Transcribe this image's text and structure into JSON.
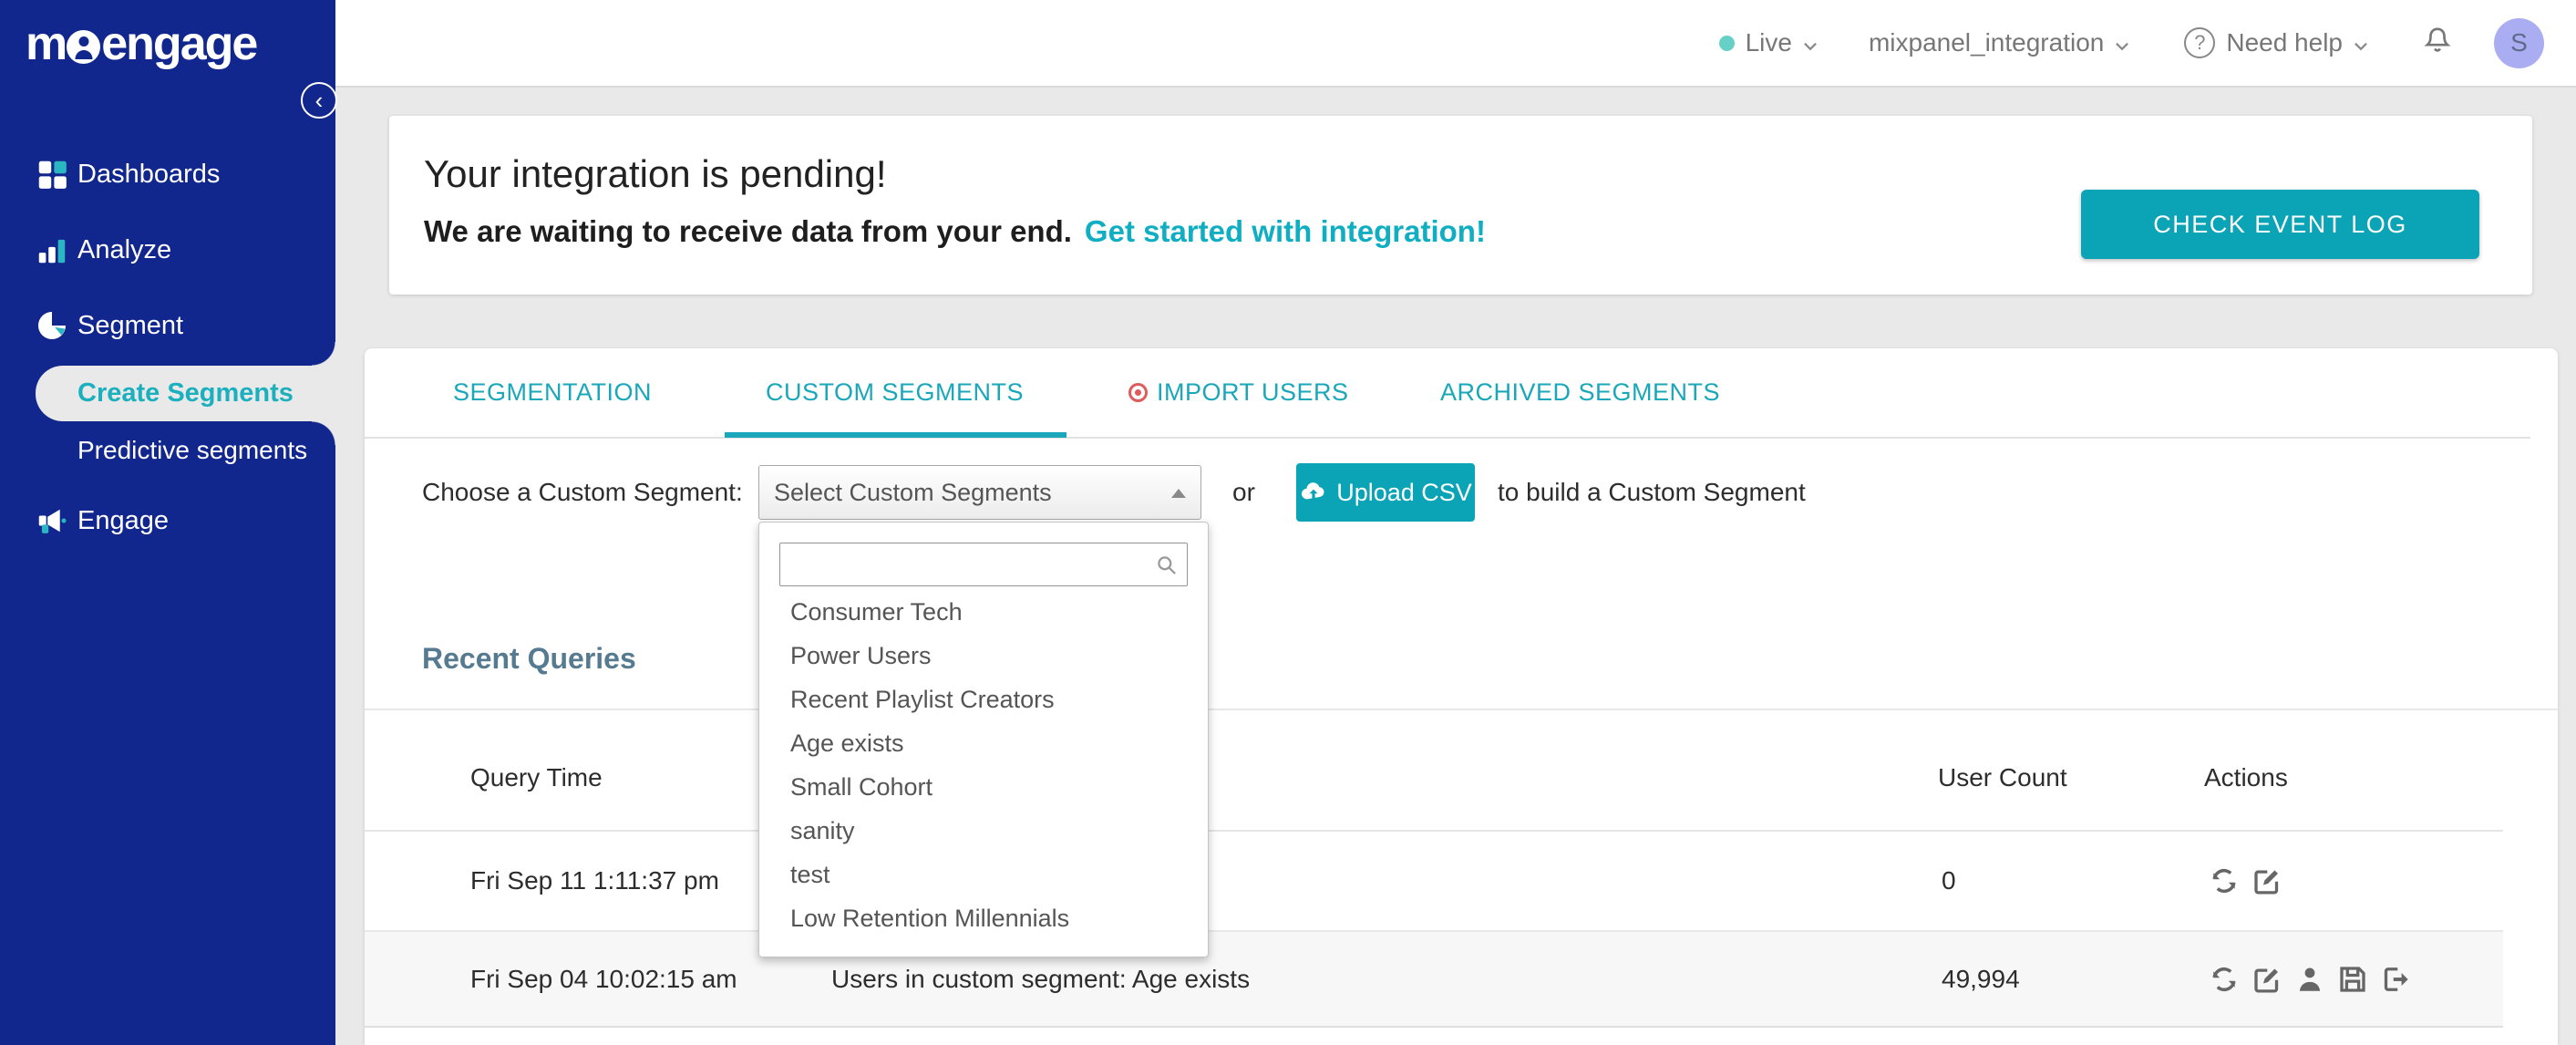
{
  "sidebar": {
    "logo": "m",
    "logo_rest": "engage",
    "items": [
      {
        "label": "Dashboards"
      },
      {
        "label": "Analyze"
      },
      {
        "label": "Segment"
      },
      {
        "label": "Engage"
      }
    ],
    "sub_items": [
      {
        "label": "Create Segments"
      },
      {
        "label": "Predictive segments"
      }
    ],
    "collapse_glyph": "‹"
  },
  "topbar": {
    "environment": "Live",
    "project": "mixpanel_integration",
    "help_label": "Need help",
    "help_glyph": "?",
    "avatar_initial": "S"
  },
  "banner": {
    "title": "Your integration is pending!",
    "subtitle": "We are waiting to receive data from your end.",
    "link": "Get started with integration!",
    "button": "CHECK EVENT LOG"
  },
  "tabs": {
    "items": [
      {
        "label": "SEGMENTATION"
      },
      {
        "label": "CUSTOM SEGMENTS"
      },
      {
        "label": "IMPORT USERS"
      },
      {
        "label": "ARCHIVED SEGMENTS"
      }
    ]
  },
  "chooser": {
    "label": "Choose a Custom Segment:",
    "selected_value": "Select Custom Segments",
    "conjunction": "or",
    "upload_label": "Upload CSV",
    "suffix": "to build a Custom Segment"
  },
  "segment_dropdown": {
    "options": [
      "Consumer Tech",
      "Power Users",
      "Recent Playlist Creators",
      "Age exists",
      "Small Cohort",
      "sanity",
      "test",
      "Low Retention Millennials"
    ]
  },
  "recent_queries": {
    "heading": "Recent Queries",
    "columns": {
      "time": "Query Time",
      "count": "User Count",
      "actions": "Actions"
    },
    "rows": [
      {
        "time": "Fri Sep 11 1:11:37 pm",
        "query": "",
        "count": "0"
      },
      {
        "time": "Fri Sep 04 10:02:15 am",
        "query": "Users in custom segment: Age exists",
        "count": "49,994"
      }
    ]
  },
  "colors": {
    "sidebar_navy": "#12278d",
    "accent_teal": "#0ba3b6",
    "tab_teal": "#1aa7ba",
    "active_item_teal": "#1cb0be",
    "link_teal": "#10aec2",
    "live_dot_teal": "#67d0c6",
    "import_badge_red": "#e05c5c",
    "avatar_purple": "#abadf2",
    "heading_slate": "#567a90",
    "row_alt_gray": "#f7f7f7"
  }
}
